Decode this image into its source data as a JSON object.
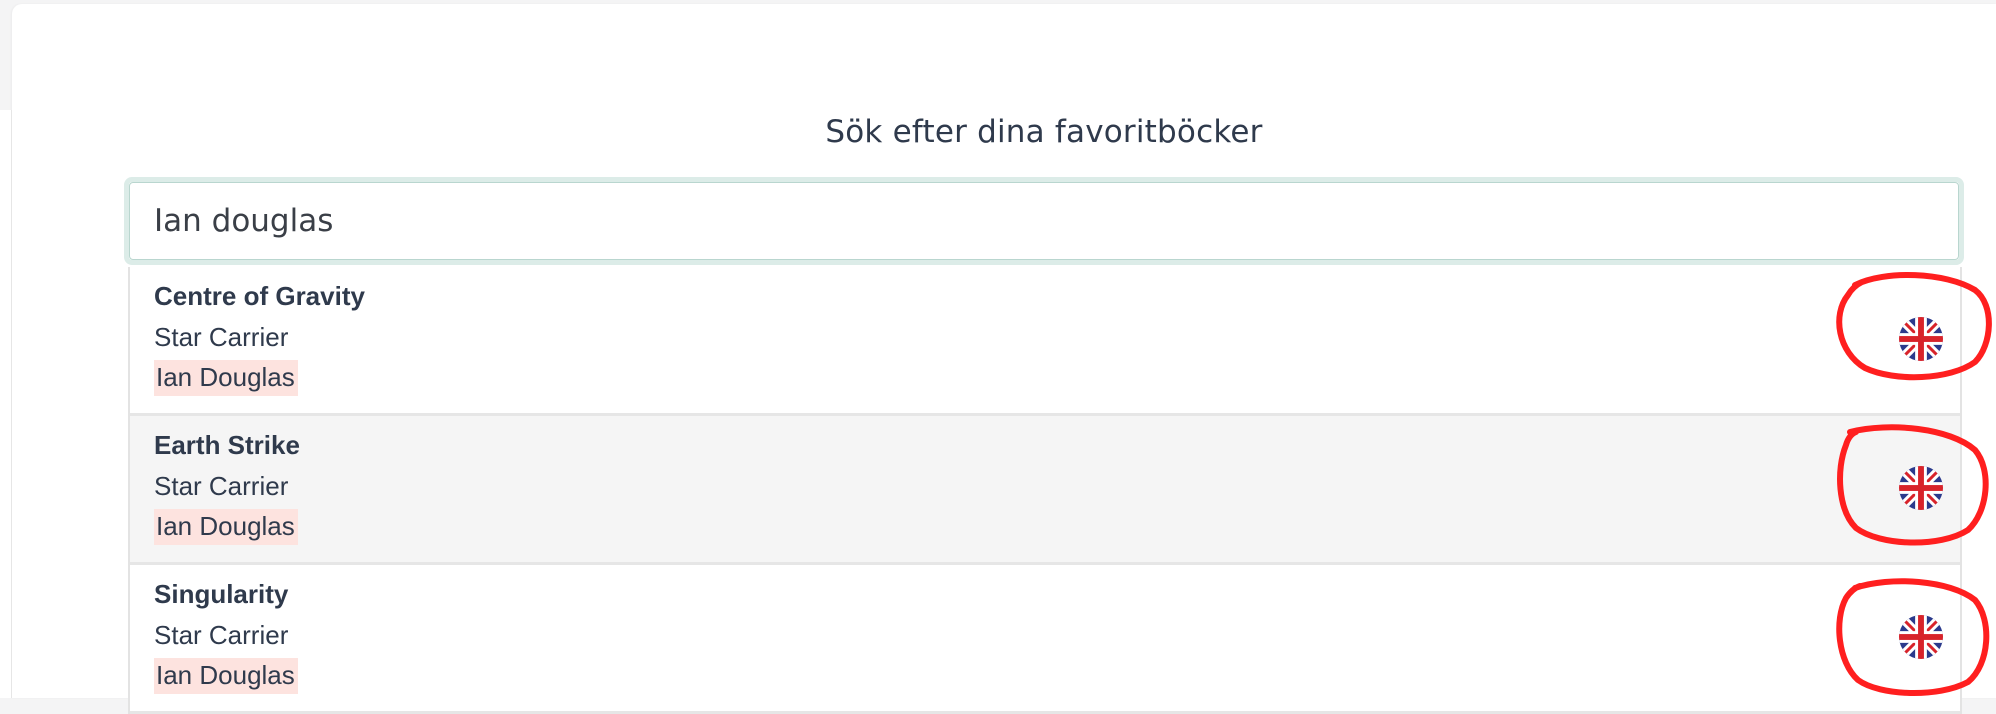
{
  "heading": "Sök efter dina favoritböcker",
  "search": {
    "value": "Ian douglas"
  },
  "results": [
    {
      "title": "Centre of Gravity",
      "series": "Star Carrier",
      "author": "Ian Douglas",
      "language_icon": "uk-flag-icon"
    },
    {
      "title": "Earth Strike",
      "series": "Star Carrier",
      "author": "Ian Douglas",
      "language_icon": "uk-flag-icon"
    },
    {
      "title": "Singularity",
      "series": "Star Carrier",
      "author": "Ian Douglas",
      "language_icon": "uk-flag-icon"
    }
  ],
  "colors": {
    "text": "#2f3a4c",
    "highlight": "#fde3df",
    "input_focus_ring": "#dcece8",
    "annotation": "#ff1f1f",
    "flag_blue": "#2b3a8c",
    "flag_red": "#d8232a"
  }
}
